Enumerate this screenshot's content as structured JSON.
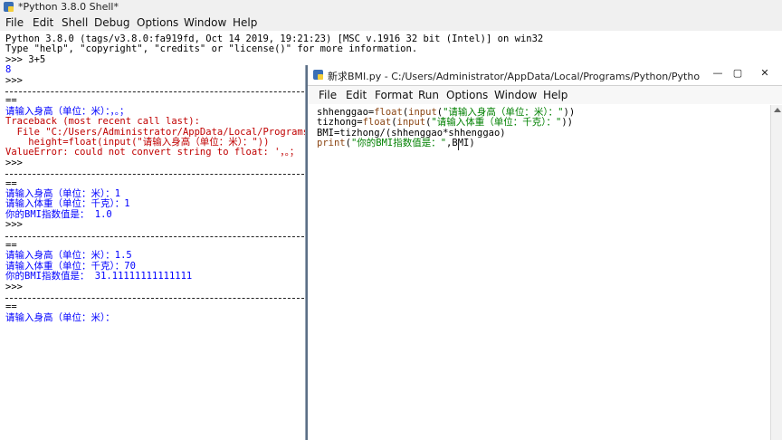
{
  "shell": {
    "title": "*Python 3.8.0 Shell*",
    "menu": [
      "File",
      "Edit",
      "Shell",
      "Debug",
      "Options",
      "Window",
      "Help"
    ],
    "lines": [
      {
        "t": "Python 3.8.0 (tags/v3.8.0:fa919fd, Oct 14 2019, 19:21:23) [MSC v.1916 32 bit (Intel)] on win32",
        "c": "blk"
      },
      {
        "t": "Type \"help\", \"copyright\", \"credits\" or \"license()\" for more information.",
        "c": "blk"
      },
      {
        "t": ">>> 3+5",
        "c": "blk"
      },
      {
        "t": "8",
        "c": "blu"
      },
      {
        "t": ">>>",
        "c": "blk"
      },
      {
        "t": "",
        "c": "sep"
      },
      {
        "t": "==",
        "c": "blk"
      },
      {
        "t": "请输入身高（单位：米）：，。；",
        "c": "blu"
      },
      {
        "t": "Traceback (most recent call last):",
        "c": "red"
      },
      {
        "t": "  File \"C:/Users/Administrator/AppData/Local/Programs/",
        "c": "red"
      },
      {
        "t": "    height=float(input(\"请输入身高（单位：米）：\"))",
        "c": "red"
      },
      {
        "t": "ValueError: could not convert string to float: '，。；",
        "c": "red"
      },
      {
        "t": ">>>",
        "c": "blk"
      },
      {
        "t": "",
        "c": "sep"
      },
      {
        "t": "==",
        "c": "blk"
      },
      {
        "t": "请输入身高（单位：米）：1",
        "c": "blu"
      },
      {
        "t": "请输入体重（单位：千克）：1",
        "c": "blu"
      },
      {
        "t": "你的BMI指数值是： 1.0",
        "c": "blu"
      },
      {
        "t": ">>>",
        "c": "blk"
      },
      {
        "t": "",
        "c": "sep"
      },
      {
        "t": "==",
        "c": "blk"
      },
      {
        "t": "请输入身高（单位：米）：1.5",
        "c": "blu"
      },
      {
        "t": "请输入体重（单位：千克）：70",
        "c": "blu"
      },
      {
        "t": "你的BMI指数值是： 31.11111111111111",
        "c": "blu"
      },
      {
        "t": ">>>",
        "c": "blk"
      },
      {
        "t": "",
        "c": "sep"
      },
      {
        "t": "==",
        "c": "blk"
      },
      {
        "t": "请输入身高（单位：米）：",
        "c": "blu"
      }
    ]
  },
  "editor": {
    "title": "新求BMI.py - C:/Users/Administrator/AppData/Local/Programs/Python/Python...",
    "buttons": {
      "minimize": "—",
      "maximize": "▢",
      "close": "✕"
    },
    "menu": [
      "File",
      "Edit",
      "Format",
      "Run",
      "Options",
      "Window",
      "Help"
    ],
    "code": [
      [
        {
          "t": "shhenggao=",
          "c": "blk"
        },
        {
          "t": "float",
          "c": "brn"
        },
        {
          "t": "(",
          "c": "blk"
        },
        {
          "t": "input",
          "c": "brn"
        },
        {
          "t": "(",
          "c": "blk"
        },
        {
          "t": "\"请输入身高（单位：米）：\"",
          "c": "grn"
        },
        {
          "t": "))",
          "c": "blk"
        }
      ],
      [
        {
          "t": "tizhong=",
          "c": "blk"
        },
        {
          "t": "float",
          "c": "brn"
        },
        {
          "t": "(",
          "c": "blk"
        },
        {
          "t": "input",
          "c": "brn"
        },
        {
          "t": "(",
          "c": "blk"
        },
        {
          "t": "\"请输入体重（单位：千克）：\"",
          "c": "grn"
        },
        {
          "t": "))",
          "c": "blk"
        }
      ],
      [
        {
          "t": "BMI=tizhong/(shhenggao*shhenggao)",
          "c": "blk"
        }
      ],
      [
        {
          "t": "print",
          "c": "brn"
        },
        {
          "t": "(",
          "c": "blk"
        },
        {
          "t": "\"你的BMI指数值是：\"",
          "c": "grn"
        },
        {
          "t": ",BMI)",
          "c": "blk"
        }
      ]
    ]
  }
}
